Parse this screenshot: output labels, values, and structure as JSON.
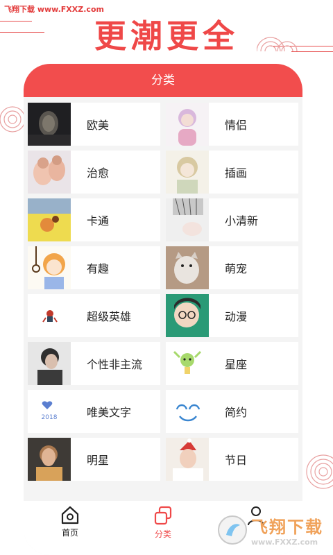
{
  "watermark_top": "飞翔下载 www.FXXZ.com",
  "headline": "更潮更全",
  "panel": {
    "title": "分类"
  },
  "categories": [
    {
      "label": "欧美",
      "thumb": "dark-portrait"
    },
    {
      "label": "情侣",
      "thumb": "pink-anime"
    },
    {
      "label": "治愈",
      "thumb": "babies"
    },
    {
      "label": "插画",
      "thumb": "anime-boy"
    },
    {
      "label": "卡通",
      "thumb": "cartoon-yellow"
    },
    {
      "label": "小清新",
      "thumb": "fresh-shirt"
    },
    {
      "label": "有趣",
      "thumb": "anime-rope"
    },
    {
      "label": "萌宠",
      "thumb": "cat"
    },
    {
      "label": "超级英雄",
      "thumb": "tiny-hero"
    },
    {
      "label": "动漫",
      "thumb": "anime-glasses"
    },
    {
      "label": "个性非主流",
      "thumb": "side-profile"
    },
    {
      "label": "星座",
      "thumb": "green-sprite"
    },
    {
      "label": "唯美文字",
      "thumb": "text-2018"
    },
    {
      "label": "简约",
      "thumb": "blue-smiley"
    },
    {
      "label": "明星",
      "thumb": "star-portrait"
    },
    {
      "label": "节日",
      "thumb": "christmas"
    }
  ],
  "thumb_text": {
    "year": "2018"
  },
  "tabs": [
    {
      "label": "首页",
      "icon": "home-icon"
    },
    {
      "label": "分类",
      "icon": "category-icon",
      "active": true
    },
    {
      "label": "",
      "icon": "user-icon"
    }
  ],
  "watermark_bottom": {
    "title": "飞翔下载",
    "url": "www.FXXZ.com"
  },
  "colors": {
    "accent": "#ef4848",
    "header": "#f24d4d",
    "panel_bg": "#f4f4f4"
  }
}
